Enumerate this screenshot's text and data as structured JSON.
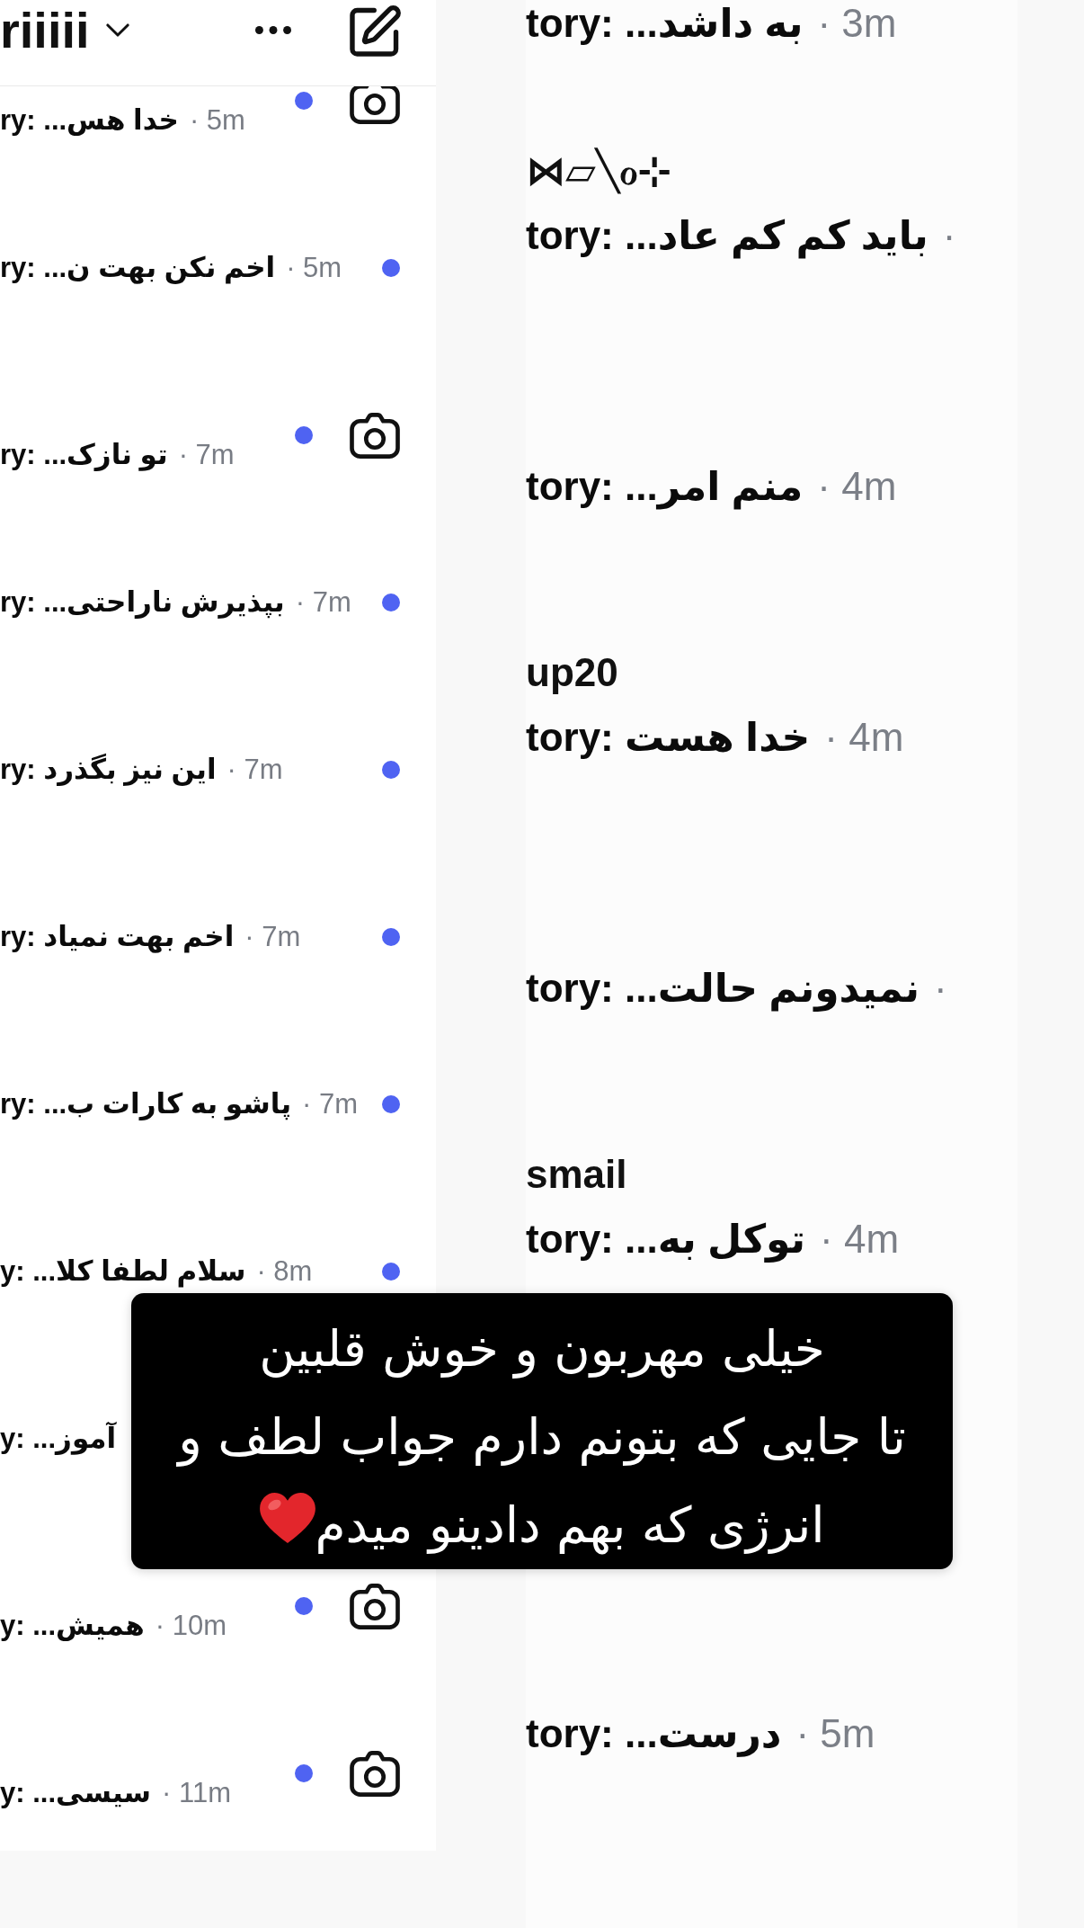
{
  "left_panel": {
    "header": {
      "title": "riiiii"
    },
    "threads": [
      {
        "prefix": "ry:",
        "message": "خدا هس...",
        "time": "· 5m",
        "unread": true,
        "camera": true
      },
      {
        "prefix": "ry:",
        "message": "اخم نکن بهت ن...",
        "time": "· 5m",
        "unread": true,
        "camera": false
      },
      {
        "prefix": "ry:",
        "message": "تو نازک...",
        "time": "· 7m",
        "unread": true,
        "camera": true
      },
      {
        "prefix": "ry:",
        "message": "بپذیرش ناراحتی...",
        "time": "· 7m",
        "unread": true,
        "camera": false
      },
      {
        "prefix": "ry:",
        "message": "این نیز بگذرد",
        "time": "· 7m",
        "unread": true,
        "camera": false
      },
      {
        "prefix": "ry:",
        "message": "اخم بهت نمیاد",
        "time": "· 7m",
        "unread": true,
        "camera": false
      },
      {
        "prefix": "ry:",
        "message": "پاشو به کارات ب...",
        "time": "· 7m",
        "unread": true,
        "camera": false
      },
      {
        "prefix": "y:",
        "message": "سلام لطفا کلا...",
        "time": "· 8m",
        "unread": true,
        "camera": false
      },
      {
        "prefix": "y:",
        "message": "آموز..."
      },
      {
        "prefix": "y:",
        "message": "همیش...",
        "time": "· 10m",
        "unread": true,
        "camera": true
      },
      {
        "prefix": "y:",
        "message": "سیسی...",
        "time": "· 11m",
        "unread": true,
        "camera": true
      }
    ]
  },
  "right_panel": {
    "threads": [
      {
        "prefix": "tory:",
        "message": "به داشد...",
        "time": "· 3m"
      },
      {
        "name": "⋈▱╲ℴ⊹",
        "prefix": "tory:",
        "message": "باید کم کم عاد...",
        "time": "·"
      },
      {
        "prefix": "tory:",
        "message": "منم امر...",
        "time": "· 4m"
      },
      {
        "name": "up20",
        "prefix": "tory:",
        "message": "خدا هست",
        "time": "· 4m"
      },
      {
        "prefix": "tory:",
        "message": "نمیدونم حالت...",
        "time": "·"
      },
      {
        "name": "smail",
        "prefix": "tory:",
        "message": "توکل به...",
        "time": "· 4m"
      },
      {
        "prefix": "tory:",
        "message": "درست...",
        "time": "· 5m"
      }
    ]
  },
  "caption": {
    "lines": [
      "خیلی مهربون و خوش قلبین",
      "تا جایی که بتونم دارم جواب لطف و",
      "انرژی که بهم دادینو میدم"
    ],
    "heart": true
  }
}
